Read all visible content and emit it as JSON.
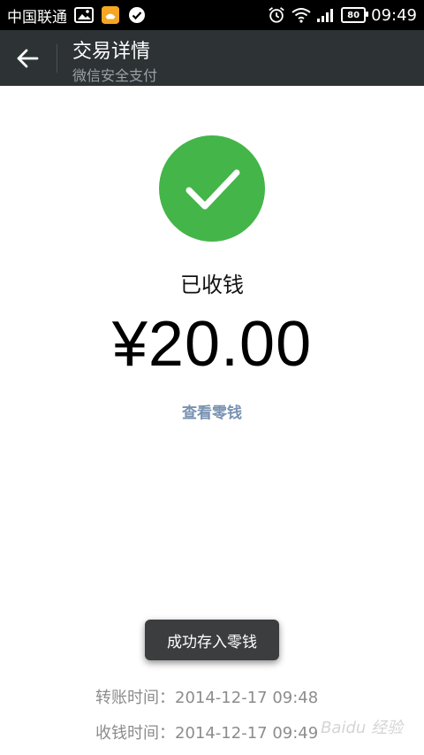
{
  "status_bar": {
    "carrier": "中国联通",
    "battery": "80",
    "time": "09:49"
  },
  "header": {
    "title": "交易详情",
    "subtitle": "微信安全支付"
  },
  "transaction": {
    "status": "已收钱",
    "amount": "¥20.00",
    "view_change_link": "查看零钱"
  },
  "toast": {
    "message": "成功存入零钱"
  },
  "details": {
    "transfer_time": "转账时间：2014-12-17 09:48",
    "receive_time": "收钱时间：2014-12-17 09:49"
  },
  "watermark": {
    "text": "Baidu 经验"
  },
  "colors": {
    "success_green": "#44b549",
    "title_bar": "#2d3235",
    "link_blue": "#7892b1"
  }
}
